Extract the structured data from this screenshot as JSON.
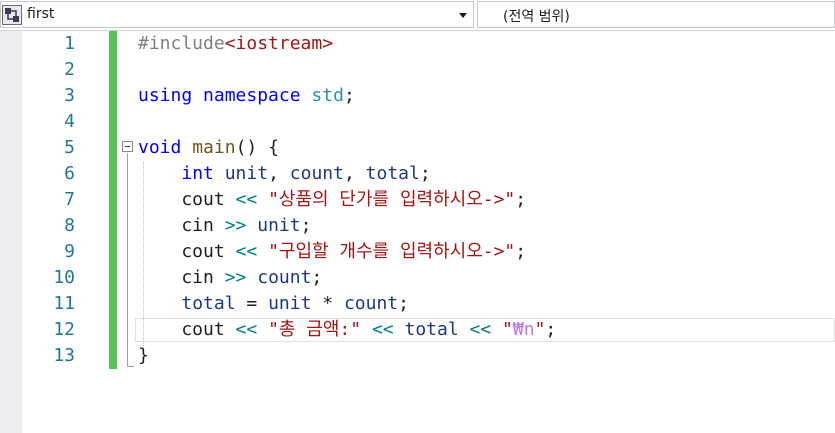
{
  "navigation_bar": {
    "scope_label": "first",
    "scope_icon": "project-scope-icon",
    "member_label": "(전역 범위)"
  },
  "editor": {
    "line_numbers": [
      "1",
      "2",
      "3",
      "4",
      "5",
      "6",
      "7",
      "8",
      "9",
      "10",
      "11",
      "12",
      "13"
    ],
    "lines": [
      [
        {
          "t": "#include",
          "c": "pp"
        },
        {
          "t": "<iostream>",
          "c": "inc"
        }
      ],
      [],
      [
        {
          "t": "using",
          "c": "kw"
        },
        {
          "t": " ",
          "c": "punc"
        },
        {
          "t": "namespace",
          "c": "kw"
        },
        {
          "t": " ",
          "c": "punc"
        },
        {
          "t": "std",
          "c": "ns"
        },
        {
          "t": ";",
          "c": "punc"
        }
      ],
      [],
      [
        {
          "t": "void",
          "c": "kw"
        },
        {
          "t": " ",
          "c": "punc"
        },
        {
          "t": "main",
          "c": "fn"
        },
        {
          "t": "() {",
          "c": "punc"
        }
      ],
      [
        {
          "t": "    ",
          "c": "punc"
        },
        {
          "t": "int",
          "c": "kw"
        },
        {
          "t": " ",
          "c": "punc"
        },
        {
          "t": "unit",
          "c": "var"
        },
        {
          "t": ", ",
          "c": "punc"
        },
        {
          "t": "count",
          "c": "var"
        },
        {
          "t": ", ",
          "c": "punc"
        },
        {
          "t": "total",
          "c": "var"
        },
        {
          "t": ";",
          "c": "punc"
        }
      ],
      [
        {
          "t": "    cout ",
          "c": "punc"
        },
        {
          "t": "<<",
          "c": "op"
        },
        {
          "t": " ",
          "c": "punc"
        },
        {
          "t": "\"상품의 단가를 입력하시오->\"",
          "c": "str"
        },
        {
          "t": ";",
          "c": "punc"
        }
      ],
      [
        {
          "t": "    cin ",
          "c": "punc"
        },
        {
          "t": ">>",
          "c": "op"
        },
        {
          "t": " ",
          "c": "punc"
        },
        {
          "t": "unit",
          "c": "var"
        },
        {
          "t": ";",
          "c": "punc"
        }
      ],
      [
        {
          "t": "    cout ",
          "c": "punc"
        },
        {
          "t": "<<",
          "c": "op"
        },
        {
          "t": " ",
          "c": "punc"
        },
        {
          "t": "\"구입할 개수를 입력하시오->\"",
          "c": "str"
        },
        {
          "t": ";",
          "c": "punc"
        }
      ],
      [
        {
          "t": "    cin ",
          "c": "punc"
        },
        {
          "t": ">>",
          "c": "op"
        },
        {
          "t": " ",
          "c": "punc"
        },
        {
          "t": "count",
          "c": "var"
        },
        {
          "t": ";",
          "c": "punc"
        }
      ],
      [
        {
          "t": "    ",
          "c": "punc"
        },
        {
          "t": "total",
          "c": "var"
        },
        {
          "t": " = ",
          "c": "punc"
        },
        {
          "t": "unit",
          "c": "var"
        },
        {
          "t": " * ",
          "c": "punc"
        },
        {
          "t": "count",
          "c": "var"
        },
        {
          "t": ";",
          "c": "punc"
        }
      ],
      [
        {
          "t": "    cout ",
          "c": "punc"
        },
        {
          "t": "<<",
          "c": "op"
        },
        {
          "t": " ",
          "c": "punc"
        },
        {
          "t": "\"총 금액:\"",
          "c": "str"
        },
        {
          "t": " ",
          "c": "punc"
        },
        {
          "t": "<<",
          "c": "op"
        },
        {
          "t": " ",
          "c": "punc"
        },
        {
          "t": "total",
          "c": "var"
        },
        {
          "t": " ",
          "c": "punc"
        },
        {
          "t": "<<",
          "c": "op"
        },
        {
          "t": " ",
          "c": "punc"
        },
        {
          "t": "\"",
          "c": "str"
        },
        {
          "t": "₩n",
          "c": "esc"
        },
        {
          "t": "\"",
          "c": "str"
        },
        {
          "t": ";",
          "c": "punc"
        }
      ],
      [
        {
          "t": "}",
          "c": "punc"
        }
      ]
    ]
  },
  "colors": {
    "line_number": "#237893",
    "keyword": "#0000ff",
    "string": "#a31515",
    "preprocessor": "#808080",
    "variable": "#1f377f",
    "function": "#74531f",
    "operator": "#008080",
    "escape": "#b776fb",
    "change_bar": "#57c357"
  }
}
